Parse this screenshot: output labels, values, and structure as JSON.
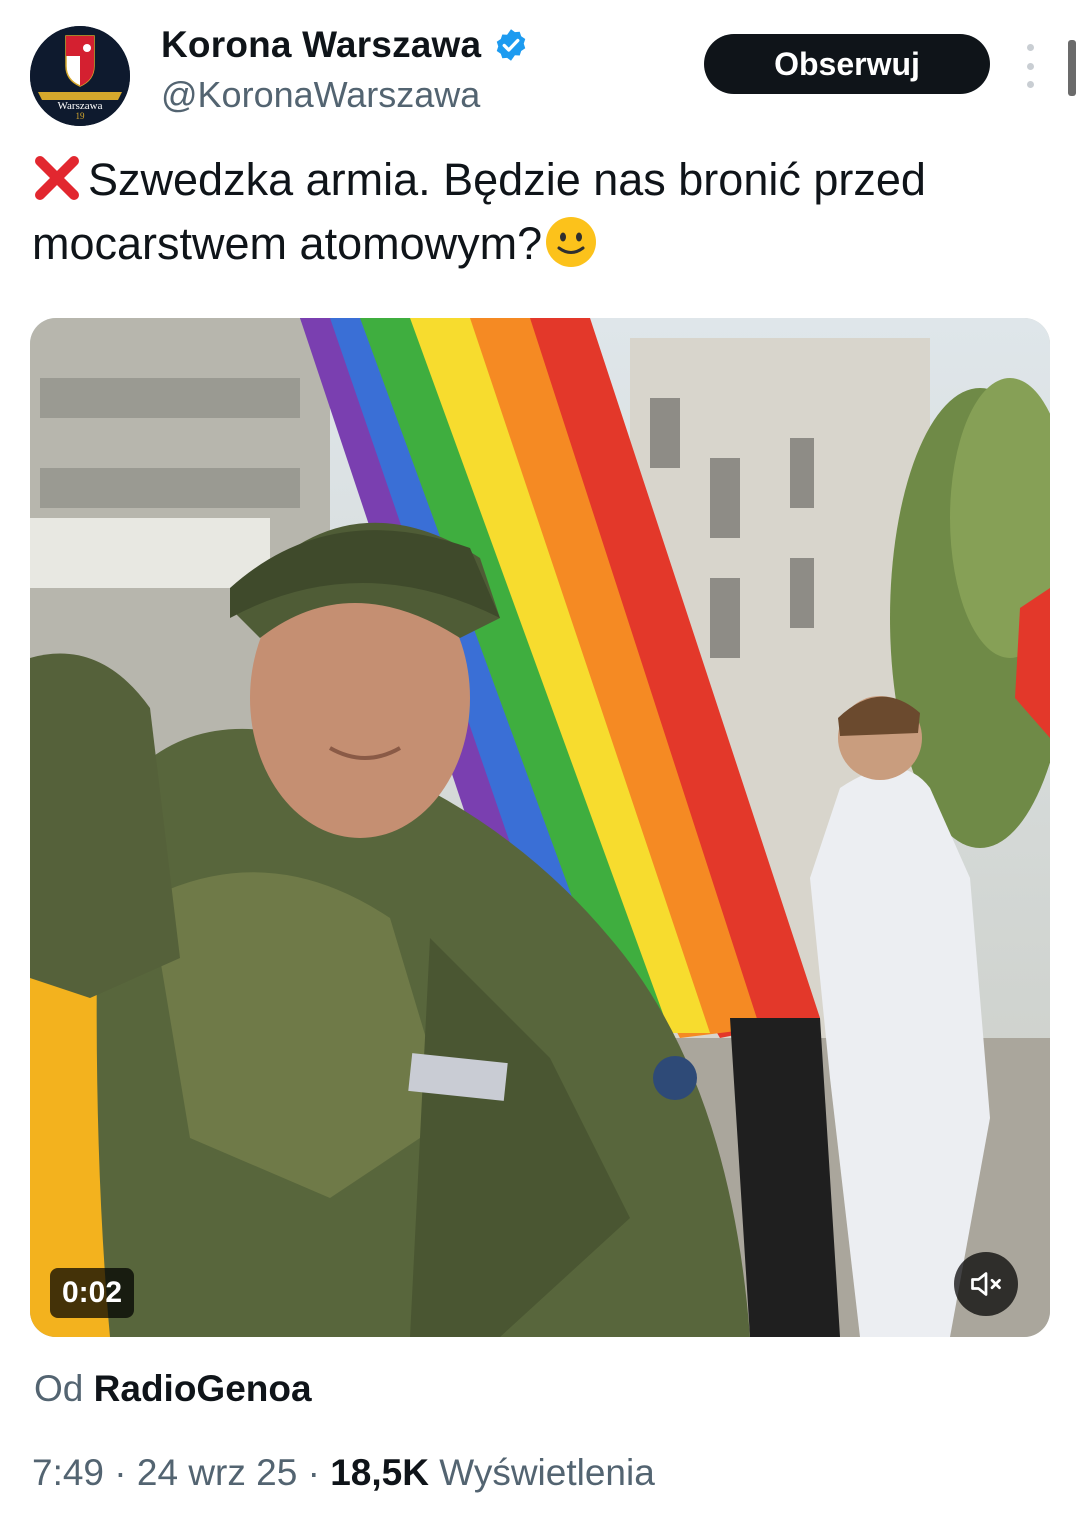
{
  "account": {
    "display_name": "Korona Warszawa",
    "handle": "@KoronaWarszawa",
    "avatar_text": "Warszawa",
    "avatar_number": "19",
    "verified": true
  },
  "actions": {
    "follow_label": "Obserwuj"
  },
  "tweet": {
    "text_line1": "Szwedzka armia. Będzie nas bronić przed",
    "text_line2": "mocarstwem atomowym?"
  },
  "video": {
    "duration": "0:02",
    "muted": true
  },
  "source": {
    "prefix": "Od",
    "name": "RadioGenoa"
  },
  "meta": {
    "time": "7:49",
    "sep1": " · ",
    "date": "24 wrz 25",
    "sep2": " · ",
    "views_count": "18,5K",
    "views_label": " Wyświetlenia"
  },
  "colors": {
    "text_primary": "#0f1419",
    "text_secondary": "#536471",
    "verified_blue": "#1d9bf0",
    "follow_bg": "#0f1419"
  }
}
